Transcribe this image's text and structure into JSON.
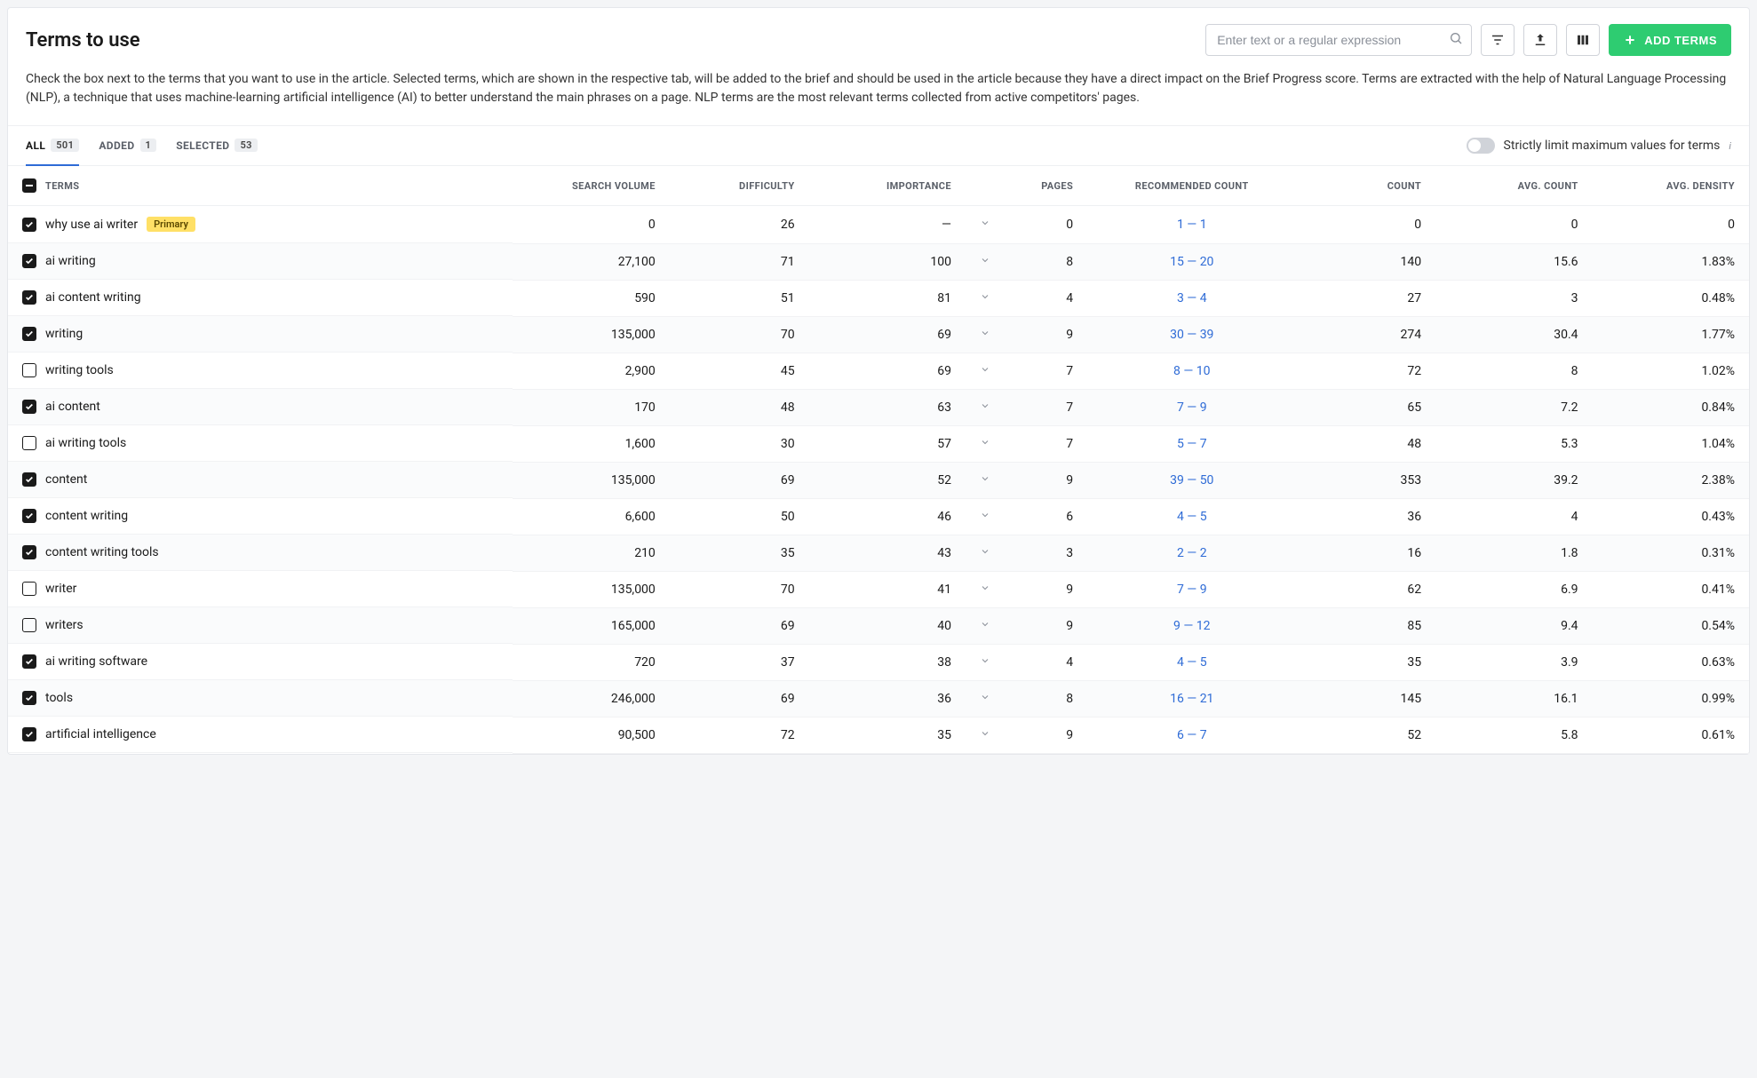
{
  "title": "Terms to use",
  "search_placeholder": "Enter text or a regular expression",
  "add_button": "ADD TERMS",
  "description": "Check the box next to the terms that you want to use in the article. Selected terms, which are shown in the respective tab, will be added to the brief and should be used in the article because they have a direct impact on the Brief Progress score. Terms are extracted with the help of Natural Language Processing (NLP), a technique that uses machine-learning artificial intelligence (AI) to better understand the main phrases on a page. NLP terms are the most relevant terms collected from active competitors' pages.",
  "tabs": {
    "all": {
      "label": "ALL",
      "count": "501"
    },
    "added": {
      "label": "ADDED",
      "count": "1"
    },
    "selected": {
      "label": "SELECTED",
      "count": "53"
    }
  },
  "toggle_label": "Strictly limit maximum values for terms",
  "columns": {
    "terms": "TERMS",
    "search_volume": "SEARCH VOLUME",
    "difficulty": "DIFFICULTY",
    "importance": "IMPORTANCE",
    "pages": "PAGES",
    "recommended": "RECOMMENDED COUNT",
    "count": "COUNT",
    "avg_count": "AVG. COUNT",
    "avg_density": "AVG. DENSITY"
  },
  "primary_badge": "Primary",
  "rows": [
    {
      "checked": true,
      "term": "why use ai writer",
      "primary": true,
      "sv": "0",
      "diff": "26",
      "imp": "—",
      "pages": "0",
      "rec": "1 — 1",
      "count": "0",
      "avgc": "0",
      "avgd": "0"
    },
    {
      "checked": true,
      "term": "ai writing",
      "primary": false,
      "sv": "27,100",
      "diff": "71",
      "imp": "100",
      "pages": "8",
      "rec": "15 — 20",
      "count": "140",
      "avgc": "15.6",
      "avgd": "1.83%"
    },
    {
      "checked": true,
      "term": "ai content writing",
      "primary": false,
      "sv": "590",
      "diff": "51",
      "imp": "81",
      "pages": "4",
      "rec": "3 — 4",
      "count": "27",
      "avgc": "3",
      "avgd": "0.48%"
    },
    {
      "checked": true,
      "term": "writing",
      "primary": false,
      "sv": "135,000",
      "diff": "70",
      "imp": "69",
      "pages": "9",
      "rec": "30 — 39",
      "count": "274",
      "avgc": "30.4",
      "avgd": "1.77%"
    },
    {
      "checked": false,
      "term": "writing tools",
      "primary": false,
      "sv": "2,900",
      "diff": "45",
      "imp": "69",
      "pages": "7",
      "rec": "8 — 10",
      "count": "72",
      "avgc": "8",
      "avgd": "1.02%"
    },
    {
      "checked": true,
      "term": "ai content",
      "primary": false,
      "sv": "170",
      "diff": "48",
      "imp": "63",
      "pages": "7",
      "rec": "7 — 9",
      "count": "65",
      "avgc": "7.2",
      "avgd": "0.84%"
    },
    {
      "checked": false,
      "term": "ai writing tools",
      "primary": false,
      "sv": "1,600",
      "diff": "30",
      "imp": "57",
      "pages": "7",
      "rec": "5 — 7",
      "count": "48",
      "avgc": "5.3",
      "avgd": "1.04%"
    },
    {
      "checked": true,
      "term": "content",
      "primary": false,
      "sv": "135,000",
      "diff": "69",
      "imp": "52",
      "pages": "9",
      "rec": "39 — 50",
      "count": "353",
      "avgc": "39.2",
      "avgd": "2.38%"
    },
    {
      "checked": true,
      "term": "content writing",
      "primary": false,
      "sv": "6,600",
      "diff": "50",
      "imp": "46",
      "pages": "6",
      "rec": "4 — 5",
      "count": "36",
      "avgc": "4",
      "avgd": "0.43%"
    },
    {
      "checked": true,
      "term": "content writing tools",
      "primary": false,
      "sv": "210",
      "diff": "35",
      "imp": "43",
      "pages": "3",
      "rec": "2 — 2",
      "count": "16",
      "avgc": "1.8",
      "avgd": "0.31%"
    },
    {
      "checked": false,
      "term": "writer",
      "primary": false,
      "sv": "135,000",
      "diff": "70",
      "imp": "41",
      "pages": "9",
      "rec": "7 — 9",
      "count": "62",
      "avgc": "6.9",
      "avgd": "0.41%"
    },
    {
      "checked": false,
      "term": "writers",
      "primary": false,
      "sv": "165,000",
      "diff": "69",
      "imp": "40",
      "pages": "9",
      "rec": "9 — 12",
      "count": "85",
      "avgc": "9.4",
      "avgd": "0.54%"
    },
    {
      "checked": true,
      "term": "ai writing software",
      "primary": false,
      "sv": "720",
      "diff": "37",
      "imp": "38",
      "pages": "4",
      "rec": "4 — 5",
      "count": "35",
      "avgc": "3.9",
      "avgd": "0.63%"
    },
    {
      "checked": true,
      "term": "tools",
      "primary": false,
      "sv": "246,000",
      "diff": "69",
      "imp": "36",
      "pages": "8",
      "rec": "16 — 21",
      "count": "145",
      "avgc": "16.1",
      "avgd": "0.99%"
    },
    {
      "checked": true,
      "term": "artificial intelligence",
      "primary": false,
      "sv": "90,500",
      "diff": "72",
      "imp": "35",
      "pages": "9",
      "rec": "6 — 7",
      "count": "52",
      "avgc": "5.8",
      "avgd": "0.61%"
    }
  ]
}
